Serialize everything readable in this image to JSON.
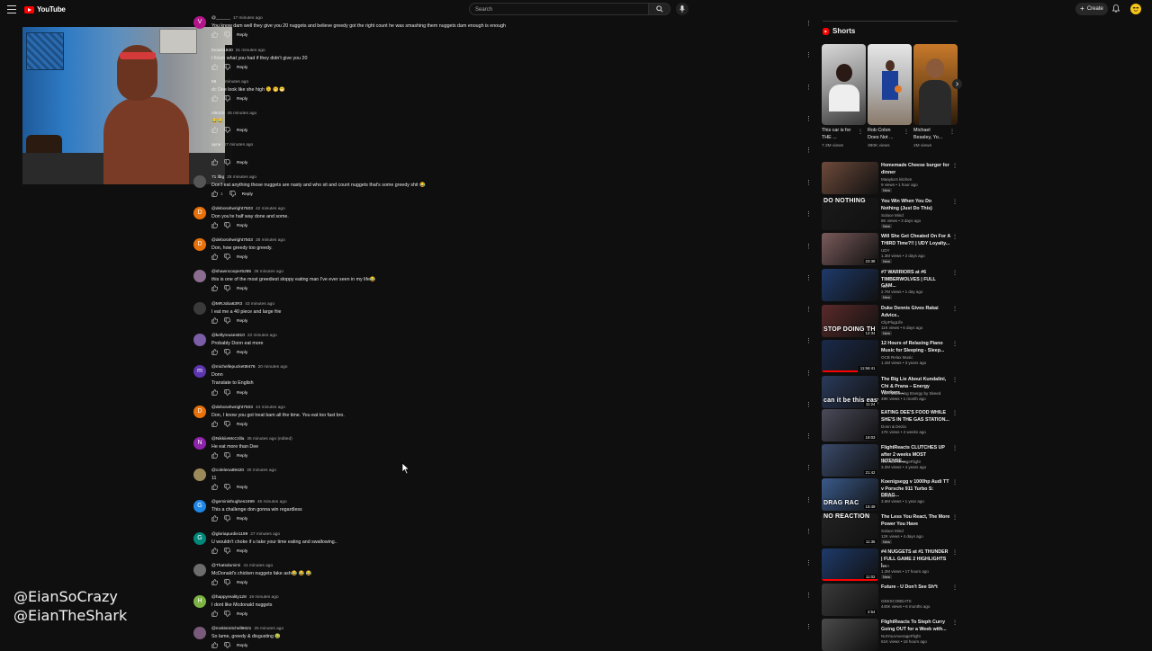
{
  "header": {
    "logo_text": "YouTube",
    "search_placeholder": "Search",
    "create_label": "Create"
  },
  "overlay": {
    "handle1": "@EianSoCrazy",
    "handle2": "@EianTheShark"
  },
  "comments": [
    {
      "avatar_letter": "V",
      "color": "#b5158b",
      "user": "@______",
      "time": "17 minutes ago",
      "text": "You know dam well they give you 20 nuggets  and believe greedy got the right count he was smashing them nuggets  dam  enough is enough",
      "reply": "Reply"
    },
    {
      "avatar_letter": "",
      "color": "#555",
      "user": "brown1840",
      "time": "21 minutes ago",
      "text": "t finish what you had if they didn't give you 20",
      "reply": "Reply"
    },
    {
      "avatar_letter": "",
      "color": "#555",
      "user": "98",
      "time": "29 minutes ago",
      "text": "dc Dee look like she high 🫠 🤭😁",
      "reply": "Reply"
    },
    {
      "avatar_letter": "",
      "color": "#555",
      "user": "ol9420",
      "time": "45 minutes ago",
      "text": "😂😂",
      "reply": "Reply"
    },
    {
      "avatar_letter": "",
      "color": "#555",
      "user": "ayne",
      "time": "47 minutes ago",
      "text": "",
      "reply": "Reply"
    },
    {
      "avatar_letter": "",
      "color": "#555",
      "user": "71 llbg",
      "time": "25 minutes ago",
      "text": "Don't eat anything those nuggets are nasty and who sit and count nuggets that's some greedy shit 😂",
      "likes": "1",
      "reply": "Reply"
    },
    {
      "avatar_letter": "D",
      "color": "#e8710a",
      "user": "@deborahwright7503",
      "time": "42 minutes ago",
      "text": "Don you're  half way done and some.",
      "reply": "Reply"
    },
    {
      "avatar_letter": "D",
      "color": "#e8710a",
      "user": "@deborahwright7503",
      "time": "38 minutes ago",
      "text": "Don, how greedy too greedy.",
      "reply": "Reply"
    },
    {
      "avatar_letter": "",
      "color": "#8b6d8f",
      "user": "@shawncooper5285",
      "time": "36 minutes ago",
      "text": "this is one of the most greediest sloppy eating man I've ever seen in my life😂",
      "reply": "Reply"
    },
    {
      "avatar_letter": "",
      "color": "#3a3a3a",
      "user": "@MRJoba63R3",
      "time": "43 minutes ago",
      "text": "I eat me a 40 piece and large frie",
      "reply": "Reply"
    },
    {
      "avatar_letter": "",
      "color": "#7b5ea7",
      "user": "@kellyreuses810",
      "time": "22 minutes ago",
      "text": "Probably Donn eat more",
      "reply": "Reply"
    },
    {
      "avatar_letter": "m",
      "color": "#5e35b1",
      "user": "@michellepuckett9476",
      "time": "20 minutes ago",
      "text": "Donn",
      "text2": "Translate to English",
      "reply": "Reply"
    },
    {
      "avatar_letter": "D",
      "color": "#e8710a",
      "user": "@deborahwright7503",
      "time": "44 minutes ago",
      "text": "Don, I know you got treat  bam all the time. You eat too fast bro.",
      "reply": "Reply"
    },
    {
      "avatar_letter": "N",
      "color": "#8e24aa",
      "user": "@NikkiieMcCrilla",
      "time": "35 minutes ago (edited)",
      "text": "He eat more than Dee",
      "reply": "Reply"
    },
    {
      "avatar_letter": "",
      "color": "#9c8a5a",
      "user": "@colelena89420",
      "time": "30 minutes ago",
      "text": "11",
      "reply": "Reply"
    },
    {
      "avatar_letter": "G",
      "color": "#1e88e5",
      "user": "@geminishughes1699",
      "time": "45 minutes ago",
      "text": "This a challenge don gonna win regardless",
      "reply": "Reply"
    },
    {
      "avatar_letter": "G",
      "color": "#00897b",
      "user": "@gloriapurdie1199",
      "time": "27 minutes ago",
      "text": "U wouldn't choke if u take your time eating and swallowing..",
      "reply": "Reply"
    },
    {
      "avatar_letter": "",
      "color": "#6d6d6d",
      "user": "@Thatsdumimi",
      "time": "41 minutes ago",
      "text": "McDonald's chicken nuggets fake ash😂 😂 😂",
      "reply": "Reply"
    },
    {
      "avatar_letter": "H",
      "color": "#7cb342",
      "user": "@happyreality128",
      "time": "19 minutes ago",
      "text": "I dont like Mcdonald nuggets",
      "reply": "Reply"
    },
    {
      "avatar_letter": "",
      "color": "#7a5a7a",
      "user": "@mokismitchell6621",
      "time": "25 minutes ago",
      "text": "So lame, greedy & disgusting 🤢",
      "reply": "Reply"
    }
  ],
  "shorts": {
    "heading": "Shorts",
    "items": [
      {
        "title": "This car is for THE ...",
        "views": "7.3M views"
      },
      {
        "title": "Rob Colon Does Not ...",
        "views": "390K views"
      },
      {
        "title": "Michael Beasley, Yo...",
        "views": "2M views"
      }
    ]
  },
  "videos": [
    {
      "title": "Homemade Cheese burger for dinner",
      "channel": "Maayka's kitchen",
      "stats": "9 views • 1 hour ago",
      "badge": "New",
      "duration": "",
      "bg": "#6d4a3a",
      "overlay": ""
    },
    {
      "title": "You Win When You Do Nothing (Just Do This)",
      "channel": "Solace Mind",
      "stats": "8K views • 3 days ago",
      "badge": "New",
      "duration": "",
      "bg": "#1a1a1a",
      "overlay": "DO NOTHING"
    },
    {
      "title": "Will She Get Cheated On For A THIRD Time?!! | UDY Loyalty...",
      "channel": "UDY",
      "stats": "1.3M views • 2 days ago",
      "badge": "New",
      "duration": "23:38",
      "bg": "#7a5a5a",
      "overlay": ""
    },
    {
      "title": "#7 WARRIORS at #6 TIMBERWOLVES | FULL GAM...",
      "channel": "NBA",
      "stats": "2.7M views • 1 day ago",
      "badge": "New",
      "duration": "",
      "bg": "#1e3a6a",
      "overlay": ""
    },
    {
      "title": "Duke Dennis Gives Rakai Advice..",
      "channel": "ClipPlugLife",
      "stats": "11K views • 6 days ago",
      "badge": "New",
      "duration": "12:34",
      "bg": "#5a2a2a",
      "overlay": "STOP DOING TH"
    },
    {
      "title": "12 Hours of Relaxing Piano Music for Sleeping - Sleep...",
      "channel": "OCB Relax Music",
      "stats": "1.1M views • 3 years ago",
      "badge": "",
      "duration": "11:56:41",
      "bg": "#1a2a4a",
      "overlay": ""
    },
    {
      "title": "The Big Lie About Kundalini, Chi & Prana – Energy Workers...",
      "channel": "The Awakening Energy by Skeed",
      "stats": "49K views • 1 month ago",
      "badge": "",
      "duration": "11:24",
      "bg": "#2a3a5a",
      "overlay": "can it be this easy?"
    },
    {
      "title": "EATING DEE'S FOOD WHILE SHE'S IN THE GAS STATION...",
      "channel": "Donn & Dezia",
      "stats": "17K views • 2 weeks ago",
      "badge": "",
      "duration": "18:03",
      "bg": "#4a4a5a",
      "overlay": ""
    },
    {
      "title": "FlightReacts CLUTCHES UP after 2 weeks MOST INTENSE...",
      "channel": "NotYourAverageFlight",
      "stats": "3.2M views • 4 years ago",
      "badge": "",
      "duration": "21:42",
      "bg": "#3a4a6a",
      "overlay": ""
    },
    {
      "title": "Koenigsegg v 1000hp Audi TT v Porsche 911 Turbo S: DRAG...",
      "channel": "carwow",
      "stats": "3.6M views • 1 year ago",
      "badge": "",
      "duration": "15:49",
      "bg": "#3a5a8a",
      "overlay": "DRAG RAC"
    },
    {
      "title": "The Less You React, The More Power You Have",
      "channel": "Solace Mind",
      "stats": "12K views • 4 days ago",
      "badge": "New",
      "duration": "11:35",
      "bg": "#222",
      "overlay": "NO REACTION"
    },
    {
      "title": "#4 NUGGETS at #1 THUNDER | FULL GAME 2 HIGHLIGHTS |...",
      "channel": "NBA",
      "stats": "1.2M views • 17 hours ago",
      "badge": "New",
      "duration": "11:02",
      "bg": "#1e3a6a",
      "overlay": ""
    },
    {
      "title": "Future - U Don't See Sh*t",
      "channel": "GEESCOBEATS",
      "stats": "440K views • 6 months ago",
      "badge": "",
      "duration": "2:54",
      "bg": "#3a3a3a",
      "overlay": ""
    },
    {
      "title": "FlightReacts To Steph Curry Going OUT for a Week with...",
      "channel": "NotYourAverageFlight",
      "stats": "61K views • 18 hours ago",
      "badge": "",
      "duration": "",
      "bg": "#4a4a4a",
      "overlay": ""
    }
  ]
}
